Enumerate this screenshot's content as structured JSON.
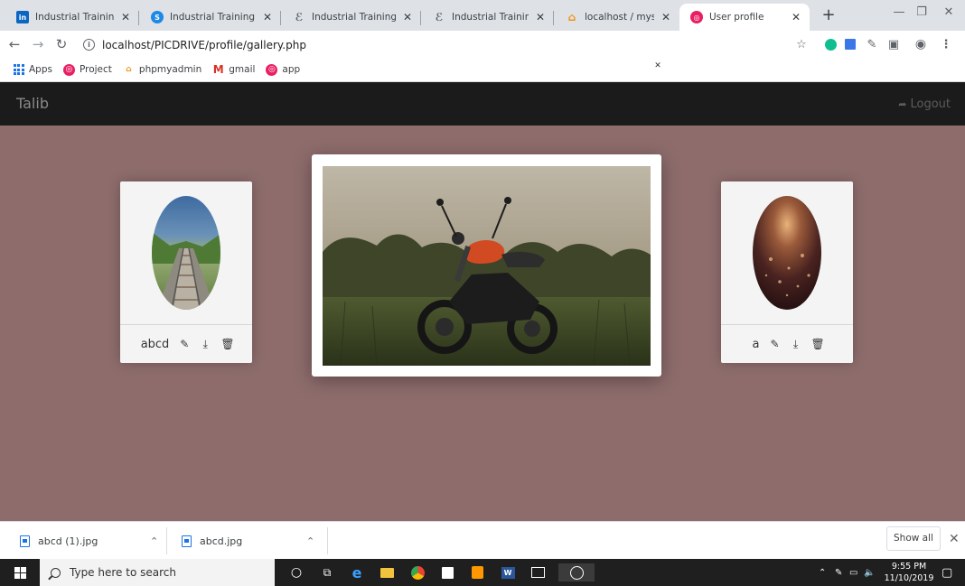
{
  "browser": {
    "tabs": [
      {
        "title": "Industrial Training Repo",
        "icon": "linkedin-icon",
        "color": "#0a66c2",
        "glyph": "in"
      },
      {
        "title": "Industrial Training Repo",
        "icon": "globe-icon",
        "color": "#1e88e5",
        "glyph": "S"
      },
      {
        "title": "Industrial Training repo",
        "icon": "training-icon",
        "color": "#5f6368",
        "glyph": "ℰ"
      },
      {
        "title": "Industrial Training repo",
        "icon": "training-icon",
        "color": "#5f6368",
        "glyph": "ℰ"
      },
      {
        "title": "localhost / mysql wamp",
        "icon": "phpmyadmin-icon",
        "color": "#f29111",
        "glyph": "⌂"
      },
      {
        "title": "User profile",
        "icon": "user-profile-icon",
        "color": "#e91e63",
        "glyph": "◎"
      }
    ],
    "new_tab": "+",
    "window_controls": {
      "minimize": "—",
      "restore": "❐",
      "close": "✕"
    },
    "address": {
      "url": "localhost/PICDRIVE/profile/gallery.php"
    },
    "bookmarks": [
      {
        "label": "Apps",
        "icon": "apps-grid-icon"
      },
      {
        "label": "Project",
        "icon": "project-icon"
      },
      {
        "label": "phpmyadmin",
        "icon": "phpmyadmin-icon"
      },
      {
        "label": "gmail",
        "icon": "gmail-icon"
      },
      {
        "label": "app",
        "icon": "app-icon"
      }
    ]
  },
  "page": {
    "brand": "Talib",
    "logout_label": "Logout",
    "colors": {
      "navbar": "#1b1b1b",
      "backdrop": "#8e6c6c",
      "card": "#f4f4f4"
    },
    "cards": [
      {
        "caption": "abcd",
        "image": "railway-track-photo"
      },
      {
        "caption": "a",
        "image": "bokeh-lights-photo"
      }
    ],
    "modal": {
      "image": "motorcycle-photo"
    }
  },
  "downloads": {
    "items": [
      {
        "name": "abcd (1).jpg"
      },
      {
        "name": "abcd.jpg"
      }
    ],
    "show_all_label": "Show all"
  },
  "taskbar": {
    "search_placeholder": "Type here to search",
    "time": "9:55 PM",
    "date": "11/10/2019"
  }
}
